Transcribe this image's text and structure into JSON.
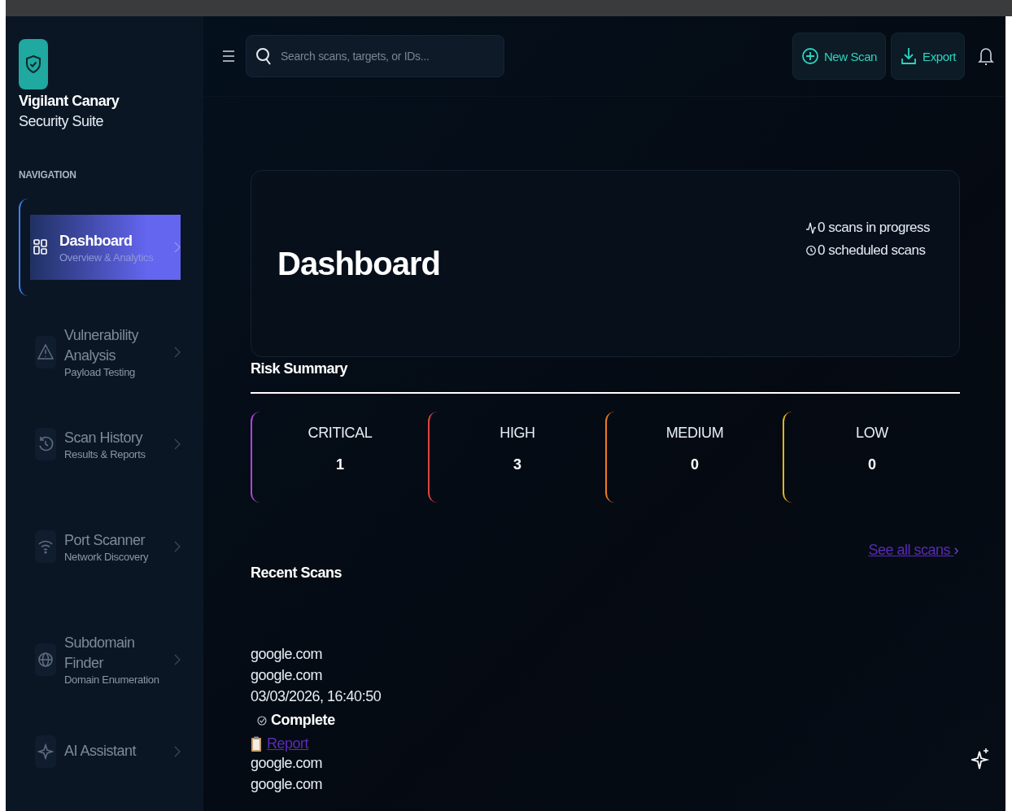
{
  "brand": {
    "name": "Vigilant Canary",
    "tagline": "Security Suite"
  },
  "sidebar": {
    "heading": "NAVIGATION",
    "items": [
      {
        "kind": "dashboard",
        "label": "Dashboard",
        "sub": "Overview & Analytics",
        "selected": true
      },
      {
        "kind": "warning",
        "label": "Vulnerability Analysis",
        "sub": "Payload Testing",
        "selected": false
      },
      {
        "kind": "history",
        "label": "Scan History",
        "sub": "Results & Reports",
        "selected": false
      },
      {
        "kind": "wifi",
        "label": "Port Scanner",
        "sub": "Network Discovery",
        "selected": false
      },
      {
        "kind": "globe",
        "label": "Subdomain Finder",
        "sub": "Domain Enumeration",
        "selected": false
      },
      {
        "kind": "ai",
        "label": "AI Assistant",
        "selected": false
      }
    ]
  },
  "topbar": {
    "search": {
      "placeholder": "Search scans, targets, or IDs..."
    },
    "buttons": [
      "New Scan",
      "Export"
    ]
  },
  "hero": {
    "title": "Dashboard",
    "stats": [
      "0 scans in progress",
      "0 scheduled scans"
    ]
  },
  "risk_summary": {
    "title": "Risk Summary",
    "levels": [
      {
        "label": "CRITICAL",
        "count": "1",
        "color": "#b044d8"
      },
      {
        "label": "HIGH",
        "count": "3",
        "color": "#e0443c"
      },
      {
        "label": "MEDIUM",
        "count": "0",
        "color": "#f07a1a"
      },
      {
        "label": "LOW",
        "count": "0",
        "color": "#e5b21a"
      }
    ]
  },
  "recent_scans": {
    "title": "Recent Scans",
    "link": "See all scans",
    "link_arrow": "›",
    "scans": [
      {
        "target": "google.com",
        "host": "google.com",
        "time": "03/03/2026, 16:40:50",
        "status": "Complete",
        "report": "Report"
      },
      {
        "target": "google.com",
        "host": "google.com"
      }
    ]
  }
}
